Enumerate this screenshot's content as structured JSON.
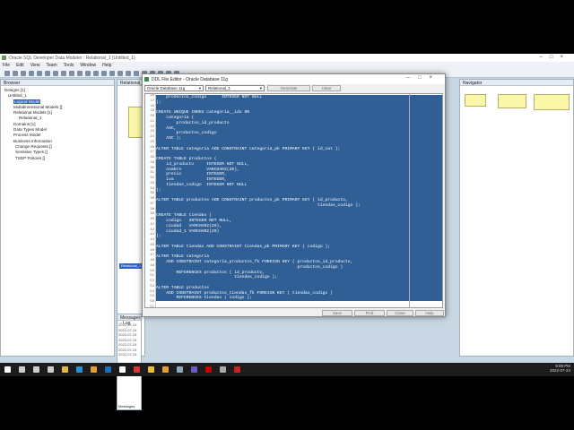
{
  "app": {
    "title": "Oracle SQL Developer Data Modeler : Relational_1 (Untitled_1)",
    "menu": [
      "File",
      "Edit",
      "View",
      "Team",
      "Tools",
      "Window",
      "Help"
    ]
  },
  "browser": {
    "title": "Browser",
    "tree": [
      "Designs [1]",
      "Untitled_1",
      "Logical Model",
      "Multidimensional Models []",
      "Relational Models [1]",
      "Relational_1",
      "Domains [1]",
      "Data Types Model",
      "Process Model",
      "Business Information",
      "Change Requests []",
      "Sensitive Types []",
      "TSDP Policies []"
    ],
    "selected": 2
  },
  "middle": {
    "tab": "Relational_1",
    "panel_tab": "Relational_1",
    "messages_title": "Messages - Log",
    "log": [
      "2022-07-24",
      "2022-07-24",
      "2022-07-24",
      "2022-07-24",
      "2022-07-24",
      "2022-07-24",
      "2022-07-24"
    ],
    "bottom_tabs": [
      "Messages",
      "Logging Page"
    ]
  },
  "navigator": {
    "title": "Navigator"
  },
  "dialog": {
    "title": "DDL File Editor - Oracle Database 11g",
    "db_select": "Oracle Database 11g",
    "model_select": "Relational_1",
    "generate": "Generate",
    "clear": "Clear",
    "buttons": [
      "Save",
      "Find",
      "Close",
      "Help"
    ],
    "first_line": 16,
    "code": [
      "    productos_codigo      INTEGER NOT NULL",
      ");",
      "",
      "CREATE UNIQUE INDEX categoria__idx ON",
      "    categoria (",
      "        productos_id_producto",
      "    ASC,",
      "        productos_codigo",
      "    ASC );",
      "",
      "ALTER TABLE categoria ADD CONSTRAINT categoria_pk PRIMARY KEY ( id_cat );",
      "",
      "CREATE TABLE productos (",
      "    id_producto     INTEGER NOT NULL,",
      "    nombre          VARCHAR2(20),",
      "    precio          INTEGER,",
      "    iva             INTEGER,",
      "    tiendas_codigo  INTEGER NOT NULL",
      ");",
      "",
      "ALTER TABLE productos ADD CONSTRAINT productos_pk PRIMARY KEY ( id_producto,",
      "                                                                tiendas_codigo );",
      "",
      "CREATE TABLE tiendas (",
      "    codigo   INTEGER NOT NULL,",
      "    ciudad   VARCHAR2(20),",
      "    ciudad_1 VARCHAR2(20)",
      ");",
      "",
      "ALTER TABLE tiendas ADD CONSTRAINT tiendas_pk PRIMARY KEY ( codigo );",
      "",
      "ALTER TABLE categoria",
      "    ADD CONSTRAINT categoria_productos_fk FOREIGN KEY ( productos_id_producto,",
      "                                                        productos_codigo )",
      "        REFERENCES productos ( id_producto,",
      "                               tiendas_codigo );",
      "",
      "ALTER TABLE productos",
      "    ADD CONSTRAINT productos_tiendas_fk FOREIGN KEY ( tiendas_codigo )",
      "        REFERENCES tiendas ( codigo );",
      "",
      ""
    ],
    "selected_lines": 40
  },
  "taskbar": {
    "time": "9:08 PM",
    "date": "2022-07-24",
    "icons": [
      "start-icon",
      "search-icon",
      "cortana-icon",
      "task-view-icon",
      "file-explorer-icon",
      "edge-icon",
      "chrome-icon",
      "outlook-icon",
      "tiktok-icon",
      "app-icon",
      "sticky-notes-icon",
      "chrome-profile-icon",
      "app-icon",
      "teams-icon",
      "acrobat-icon",
      "sql-developer-icon",
      "opera-icon"
    ]
  },
  "colors": {
    "selection": "#2f5f95",
    "taskbar": "#1c1c1c"
  }
}
